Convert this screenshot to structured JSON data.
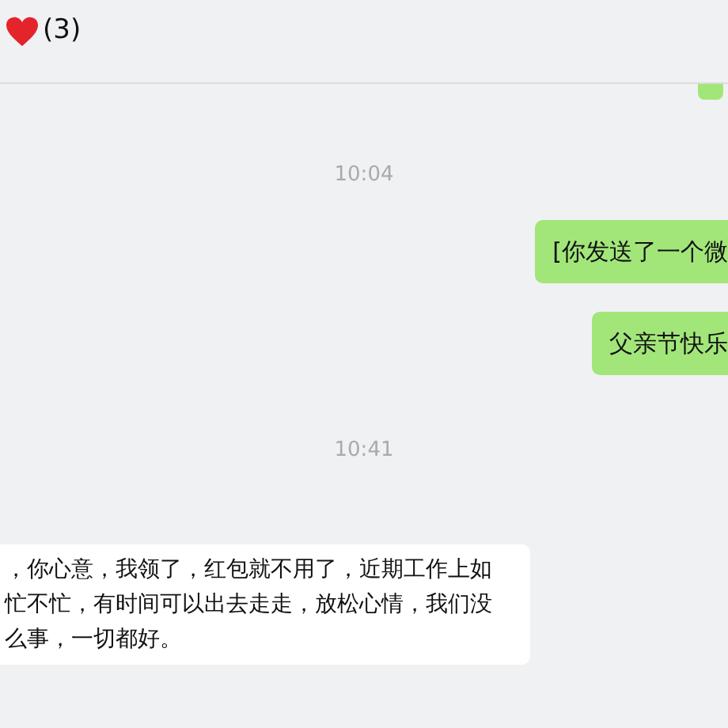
{
  "header": {
    "title": "(3)"
  },
  "messages": [
    {
      "kind": "partial"
    },
    {
      "kind": "time",
      "text": "10:04"
    },
    {
      "kind": "sent",
      "lines": [
        "[你发送了一个微"
      ]
    },
    {
      "kind": "sent",
      "lines": [
        "父亲节快乐"
      ]
    },
    {
      "kind": "time",
      "text": "10:41"
    },
    {
      "kind": "received",
      "lines": [
        "，你心意，我领了，红包就不用了，近期工作上如",
        "忙不忙，有时间可以出去走走，放松心情，我们没",
        "么事，一切都好。"
      ]
    }
  ]
}
